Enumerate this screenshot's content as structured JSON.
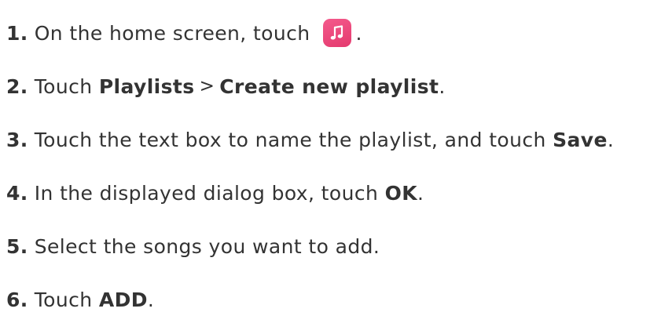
{
  "steps": [
    {
      "num": "1.",
      "text": "On the home screen, touch",
      "suffix": ".",
      "icon": "music-app-icon"
    },
    {
      "num": "2.",
      "text": "Touch",
      "bold1": "Playlists",
      "separator": ">",
      "bold2": "Create new playlist",
      "suffix": "."
    },
    {
      "num": "3.",
      "text": "Touch the text box to name the playlist, and touch",
      "bold1": "Save",
      "suffix": "."
    },
    {
      "num": "4.",
      "text": "In the displayed dialog box, touch",
      "bold1": "OK",
      "suffix": "."
    },
    {
      "num": "5.",
      "text": "Select the songs you want to add."
    },
    {
      "num": "6.",
      "text": "Touch",
      "bold1": "ADD",
      "suffix": "."
    }
  ],
  "colors": {
    "text": "#333333",
    "icon_background": "#e8457a",
    "icon_glyph": "#ffffff"
  }
}
